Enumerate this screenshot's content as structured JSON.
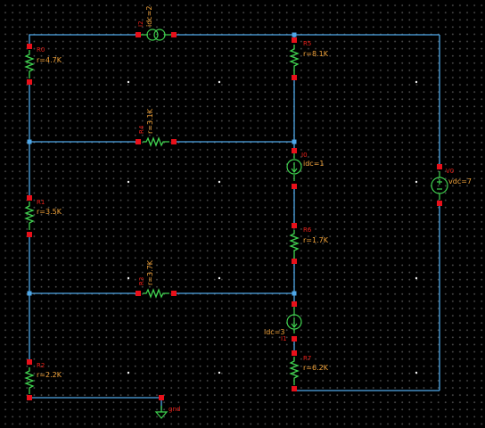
{
  "components": {
    "R0": {
      "name": "R0",
      "value": "r=4.7K"
    },
    "R5": {
      "name": "R5",
      "value": "r=8.1K"
    },
    "R4": {
      "name": "R4",
      "value": "r=3.1K"
    },
    "R1": {
      "name": "R1",
      "value": "r=3.5K"
    },
    "R6": {
      "name": "R6",
      "value": "r=1.7K"
    },
    "R3": {
      "name": "R3",
      "value": "r=3.7K"
    },
    "R2": {
      "name": "R2",
      "value": "r=2.2K"
    },
    "R7": {
      "name": "R7",
      "value": "r=6.2K"
    },
    "I2": {
      "name": "I2",
      "value": "idc=2"
    },
    "I0": {
      "name": "I0",
      "value": "idc=1"
    },
    "I1": {
      "name": "I1",
      "value": "idc=3"
    },
    "V0": {
      "name": "V0",
      "value": "vdc=7"
    },
    "GND": {
      "name": "gnd"
    }
  },
  "colors": {
    "background": "#000000",
    "wire": "#4fa8e8",
    "component": "#3fd24f",
    "pin": "#e8101a",
    "label_name": "#e8201a",
    "label_value": "#f2a33a"
  }
}
